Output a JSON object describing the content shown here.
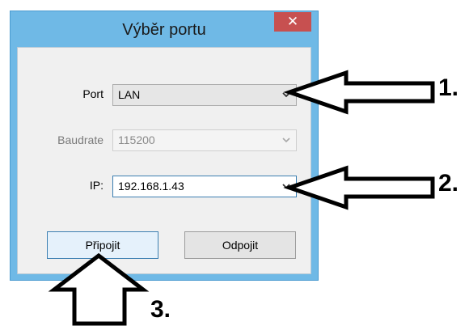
{
  "window": {
    "title": "Výběr portu",
    "close_symbol": "✕"
  },
  "form": {
    "port": {
      "label": "Port",
      "value": "LAN"
    },
    "baudrate": {
      "label": "Baudrate",
      "value": "115200"
    },
    "ip": {
      "label": "IP:",
      "value": "192.168.1.43"
    }
  },
  "buttons": {
    "connect_label": "Připojit",
    "disconnect_label": "Odpojit"
  },
  "annotations": {
    "step1": "1.",
    "step2": "2.",
    "step3": "3."
  },
  "icons": {
    "close": "close-icon",
    "dropdown": "chevron-down-icon",
    "callout_arrow": "outline-arrow-icon"
  },
  "colors": {
    "titlebar": "#6fb9e6",
    "close_button": "#c75050",
    "client_background": "#f0f0f0",
    "focus_border": "#3c7fb1"
  }
}
